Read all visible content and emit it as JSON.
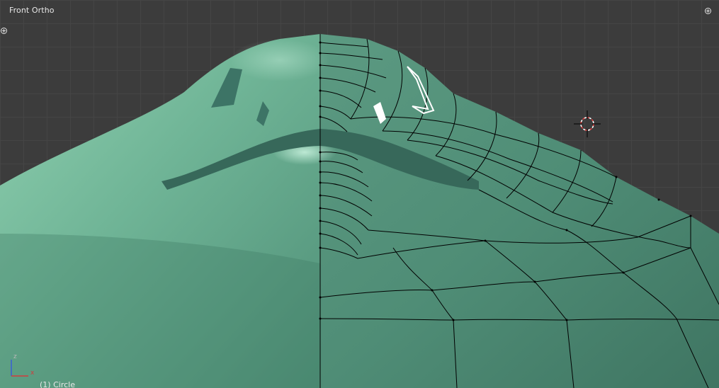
{
  "viewport": {
    "view_name": "Front Ortho",
    "object_label": "(1) Circle",
    "background_color": "#3c3c3c",
    "grid_color": "#454545",
    "mesh_color": "#5f9e86",
    "mesh_edge_color": "#000000"
  },
  "axis_gizmo": {
    "z_label": "z",
    "x_label": "x",
    "z_color": "#3a5fd6",
    "x_color": "#d23c3c"
  },
  "controls": {
    "left_toggle_icon": "plus-icon",
    "right_toggle_icon": "plus-icon"
  }
}
